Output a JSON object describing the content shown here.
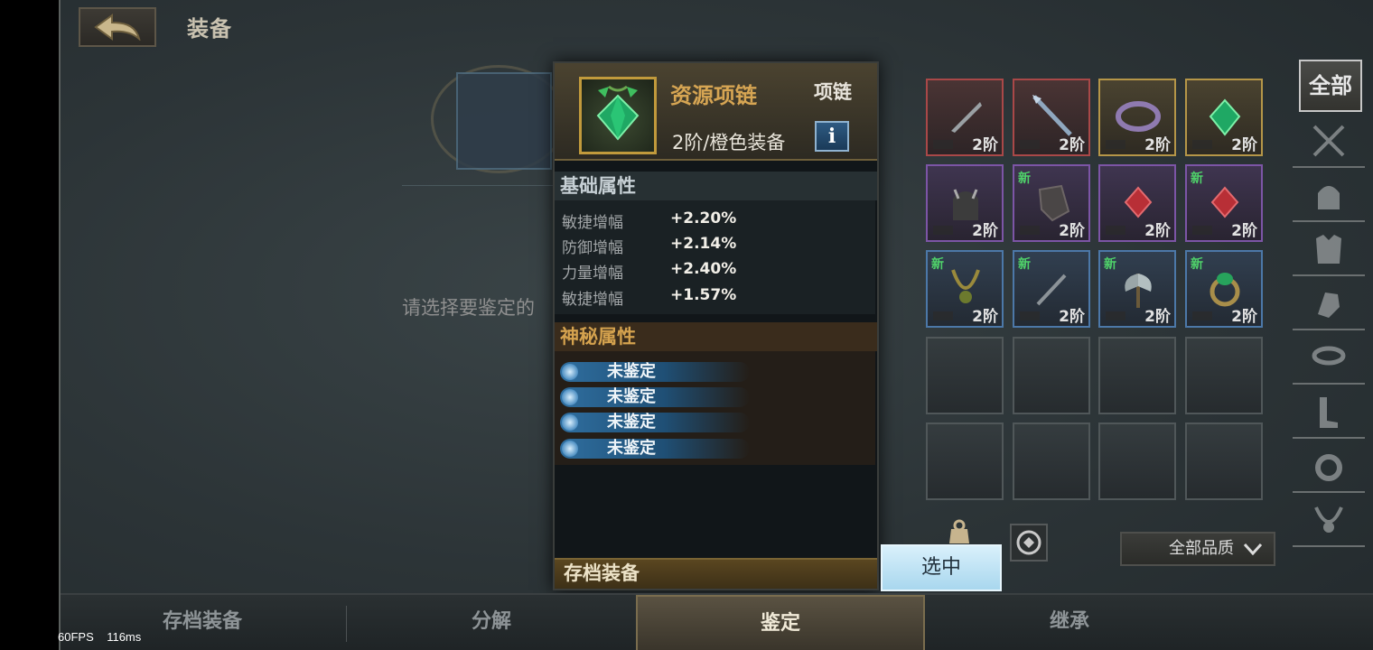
{
  "header": {
    "title": "装备"
  },
  "identify": {
    "hint": "请选择要鉴定的"
  },
  "detail": {
    "name": "资源项链",
    "type": "项链",
    "grade": "2阶/橙色装备",
    "info_label": "i",
    "basic_title": "基础属性",
    "stats": [
      {
        "name": "敏捷增幅",
        "value": "+2.20%"
      },
      {
        "name": "防御增幅",
        "value": "+2.14%"
      },
      {
        "name": "力量增幅",
        "value": "+2.40%"
      },
      {
        "name": "敏捷增幅",
        "value": "+1.57%"
      }
    ],
    "mystery_title": "神秘属性",
    "mystery": [
      "未鉴定",
      "未鉴定",
      "未鉴定",
      "未鉴定"
    ],
    "footer": "存档装备"
  },
  "select_button": "选中",
  "inventory": [
    {
      "quality": "red",
      "tier": "2阶",
      "new": "",
      "icon": "dagger-icon"
    },
    {
      "quality": "red",
      "tier": "2阶",
      "new": "",
      "icon": "spear-icon"
    },
    {
      "quality": "gold",
      "tier": "2阶",
      "new": "",
      "icon": "ring-icon"
    },
    {
      "quality": "gold",
      "tier": "2阶",
      "new": "",
      "icon": "gem-necklace-icon"
    },
    {
      "quality": "purple",
      "tier": "2阶",
      "new": "",
      "icon": "helmet-icon"
    },
    {
      "quality": "purple",
      "tier": "2阶",
      "new": "新",
      "icon": "gauntlet-icon"
    },
    {
      "quality": "purple",
      "tier": "2阶",
      "new": "",
      "icon": "red-pendant-icon"
    },
    {
      "quality": "purple",
      "tier": "2阶",
      "new": "新",
      "icon": "red-pendant-icon"
    },
    {
      "quality": "blue",
      "tier": "2阶",
      "new": "新",
      "icon": "chain-necklace-icon"
    },
    {
      "quality": "blue",
      "tier": "2阶",
      "new": "新",
      "icon": "knife-icon"
    },
    {
      "quality": "blue",
      "tier": "2阶",
      "new": "新",
      "icon": "axe-icon"
    },
    {
      "quality": "blue",
      "tier": "2阶",
      "new": "新",
      "icon": "emerald-ring-icon"
    }
  ],
  "categories": {
    "all_label": "全部"
  },
  "quality_filter": "全部品质",
  "tabs": [
    "存档装备",
    "分解",
    "鉴定",
    "继承"
  ],
  "active_tab": "鉴定",
  "overlay": {
    "fps": "60FPS",
    "latency": "116ms"
  },
  "colors": {
    "accent_gold": "#d6a553",
    "select_blue": "#a9d7ee",
    "new_green": "#4fd26a"
  }
}
